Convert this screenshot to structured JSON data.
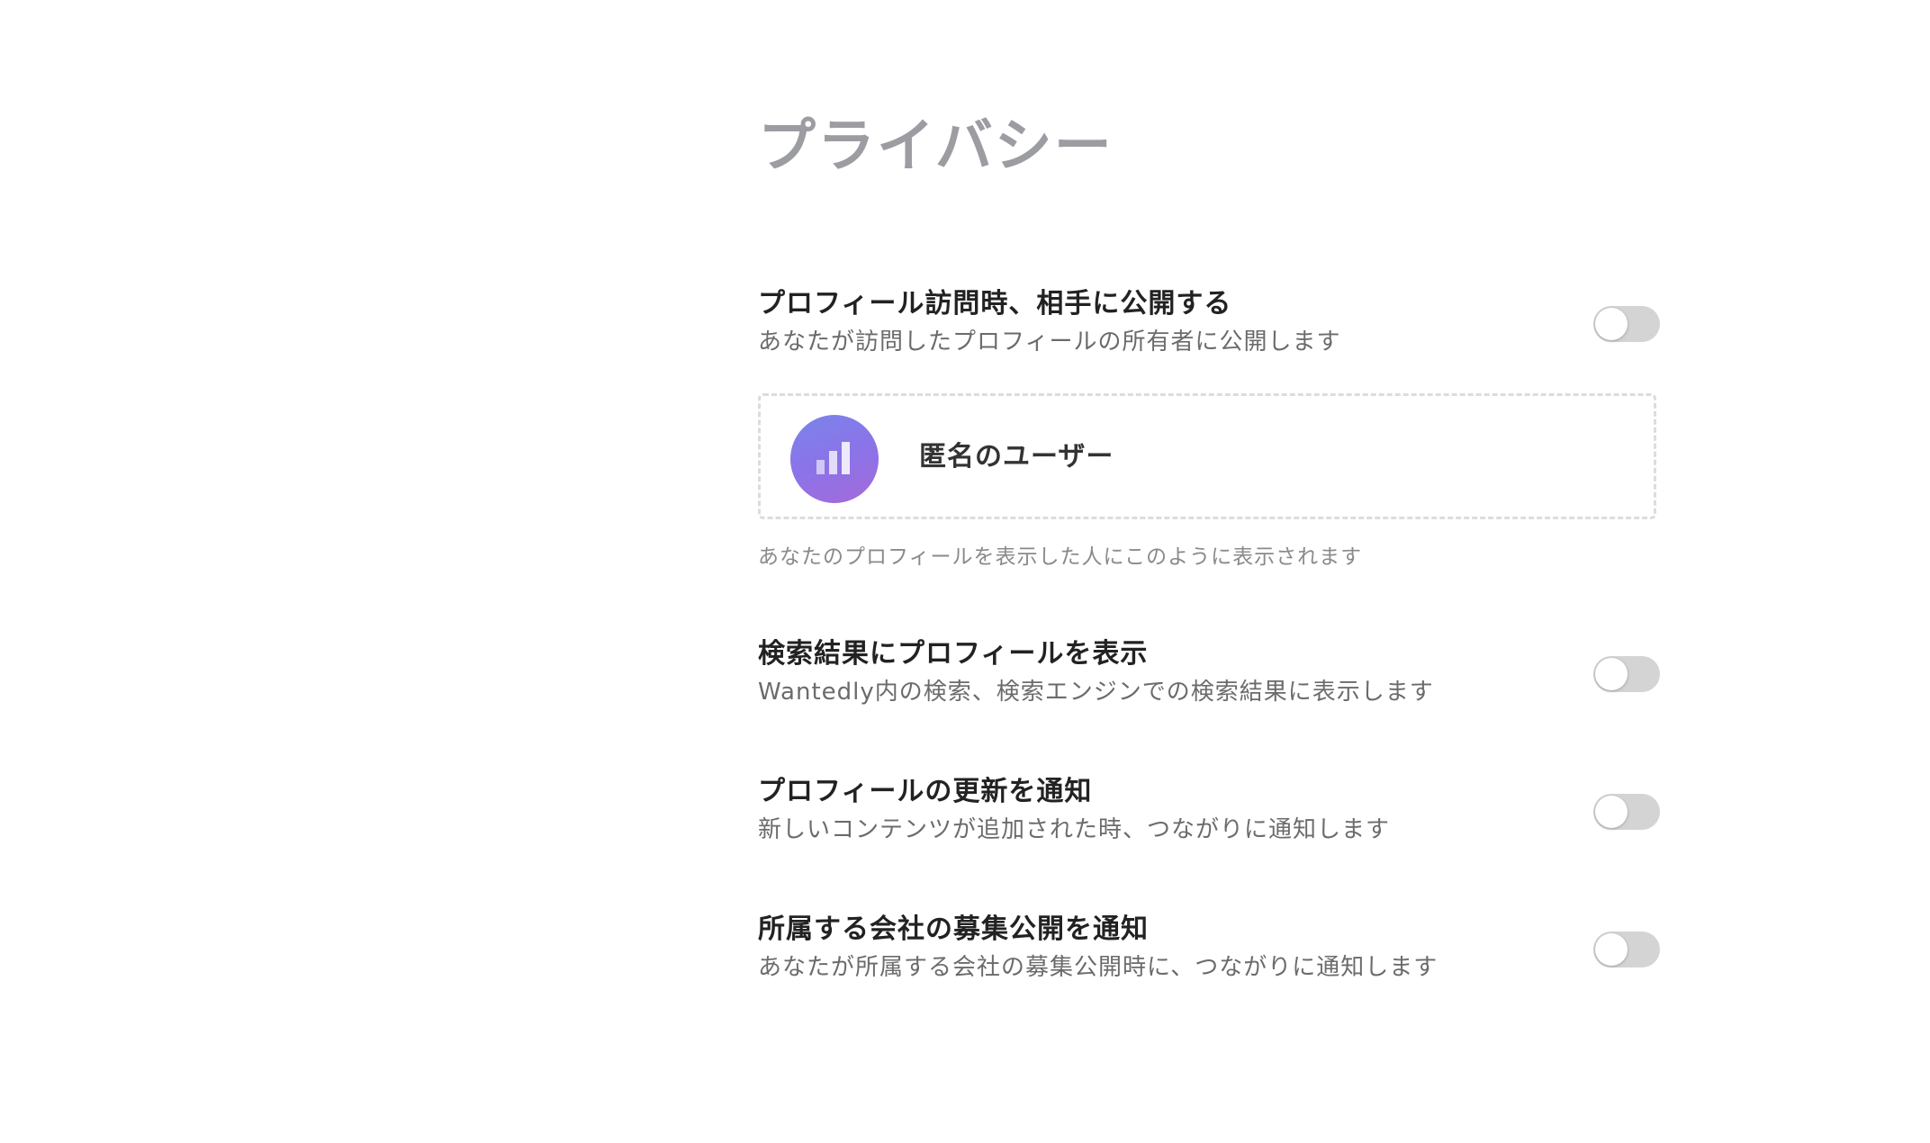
{
  "page": {
    "title": "プライバシー"
  },
  "settings": [
    {
      "title": "プロフィール訪問時、相手に公開する",
      "description": "あなたが訪問したプロフィールの所有者に公開します",
      "enabled": false
    },
    {
      "title": "検索結果にプロフィールを表示",
      "description": "Wantedly内の検索、検索エンジンでの検索結果に表示します",
      "enabled": false
    },
    {
      "title": "プロフィールの更新を通知",
      "description": "新しいコンテンツが追加された時、つながりに通知します",
      "enabled": false
    },
    {
      "title": "所属する会社の募集公開を通知",
      "description": "あなたが所属する会社の募集公開時に、つながりに通知します",
      "enabled": false
    }
  ],
  "preview": {
    "name": "匿名のユーザー",
    "caption": "あなたのプロフィールを表示した人にこのように表示されます",
    "avatar_icon": "bar-chart-icon"
  },
  "colors": {
    "title_gray": "#9c9da2",
    "toggle_off": "#d4d4d4",
    "avatar_gradient_start": "#7a84ea",
    "avatar_gradient_end": "#a46ad9"
  }
}
